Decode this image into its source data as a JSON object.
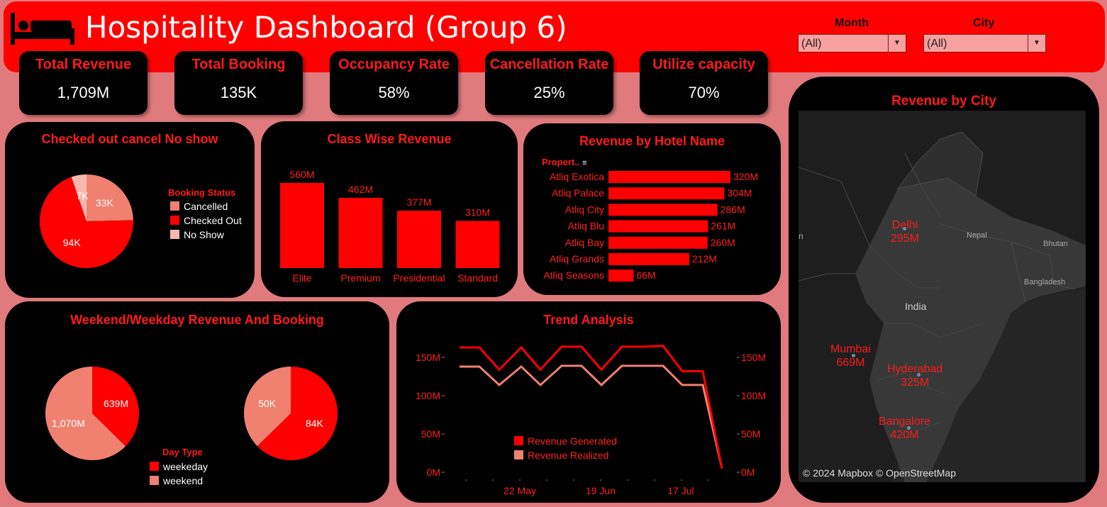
{
  "header": {
    "title": "Hospitality Dashboard (Group 6)",
    "filters": [
      {
        "label": "Month",
        "value": "(All)"
      },
      {
        "label": "City",
        "value": "(All)"
      }
    ]
  },
  "kpis": [
    {
      "label": "Total Revenue",
      "value": "1,709M"
    },
    {
      "label": "Total Booking",
      "value": "135K"
    },
    {
      "label": "Occupancy Rate",
      "value": "58%"
    },
    {
      "label": "Cancellation Rate",
      "value": "25%"
    },
    {
      "label": "Utilize capacity",
      "value": "70%"
    }
  ],
  "status_panel": {
    "title": "Checked out cancel No show",
    "legend_title": "Booking Status",
    "legend": [
      "Cancelled",
      "Checked Out",
      "No Show"
    ]
  },
  "class_panel": {
    "title": "Class Wise Revenue"
  },
  "hotel_panel": {
    "title": "Revenue by Hotel Name",
    "field_label": "Propert.."
  },
  "day_panel": {
    "title": "Weekend/Weekday Revenue And Booking",
    "legend_title": "Day Type",
    "legend": [
      "weekeday",
      "weekend"
    ]
  },
  "trend_panel": {
    "title": "Trend Analysis",
    "legend": [
      "Revenue Generated",
      "Revenue Realized"
    ]
  },
  "map_panel": {
    "title": "Revenue by City",
    "attribution": "© 2024 Mapbox © OpenStreetMap",
    "places": [
      "Nepal",
      "Bhutan",
      "Bangladesh",
      "India",
      "n"
    ],
    "cities": [
      {
        "name": "Delhi",
        "value": "295M"
      },
      {
        "name": "Mumbai",
        "value": "669M"
      },
      {
        "name": "Hyderabad",
        "value": "325M"
      },
      {
        "name": "Bangalore",
        "value": "420M"
      }
    ]
  },
  "colors": {
    "red": "#ff0000",
    "salmon": "#f08070",
    "light": "#f8b8b0",
    "background": "#e07a7d"
  },
  "chart_data": [
    {
      "type": "pie",
      "title": "Checked out cancel No show",
      "categories": [
        "Checked Out",
        "Cancelled",
        "No Show"
      ],
      "values": [
        94,
        33,
        7
      ],
      "labels": [
        "94K",
        "33K",
        "7K"
      ],
      "colors": [
        "#ff0000",
        "#f08070",
        "#f8b8b0"
      ]
    },
    {
      "type": "bar",
      "title": "Class Wise Revenue",
      "categories": [
        "Elite",
        "Premium",
        "Presidential",
        "Standard"
      ],
      "values": [
        560,
        462,
        377,
        310
      ],
      "labels": [
        "560M",
        "462M",
        "377M",
        "310M"
      ]
    },
    {
      "type": "bar",
      "orientation": "horizontal",
      "title": "Revenue by Hotel Name",
      "categories": [
        "Atliq Exotica",
        "Atliq Palace",
        "Atliq City",
        "Atliq Blu",
        "Atliq Bay",
        "Atliq Grands",
        "Atliq Seasons"
      ],
      "values": [
        320,
        304,
        286,
        261,
        260,
        212,
        66
      ],
      "labels": [
        "320M",
        "304M",
        "286M",
        "261M",
        "260M",
        "212M",
        "66M"
      ]
    },
    {
      "type": "pie",
      "title": "Weekend/Weekday Revenue",
      "categories": [
        "weekeday",
        "weekend"
      ],
      "values": [
        639,
        1070
      ],
      "labels": [
        "639M",
        "1,070M"
      ],
      "colors": [
        "#ff0000",
        "#f08070"
      ]
    },
    {
      "type": "pie",
      "title": "Weekend/Weekday Booking",
      "categories": [
        "weekeday",
        "weekend"
      ],
      "values": [
        84,
        50
      ],
      "labels": [
        "84K",
        "50K"
      ],
      "colors": [
        "#ff0000",
        "#f08070"
      ]
    },
    {
      "type": "line",
      "title": "Trend Analysis",
      "x_labels": [
        "22 May",
        "19 Jun",
        "17 Jul"
      ],
      "y_ticks": [
        "0M",
        "50M",
        "100M",
        "150M"
      ],
      "ylim": [
        0,
        175
      ],
      "series": [
        {
          "name": "Revenue Generated",
          "color": "#ff0000",
          "values": [
            163,
            163,
            134,
            163,
            134,
            164,
            164,
            134,
            164,
            164,
            165,
            132,
            132,
            5
          ]
        },
        {
          "name": "Revenue Realized",
          "color": "#f08070",
          "values": [
            138,
            138,
            114,
            138,
            114,
            139,
            139,
            114,
            139,
            139,
            139,
            114,
            114,
            5
          ]
        }
      ]
    }
  ]
}
